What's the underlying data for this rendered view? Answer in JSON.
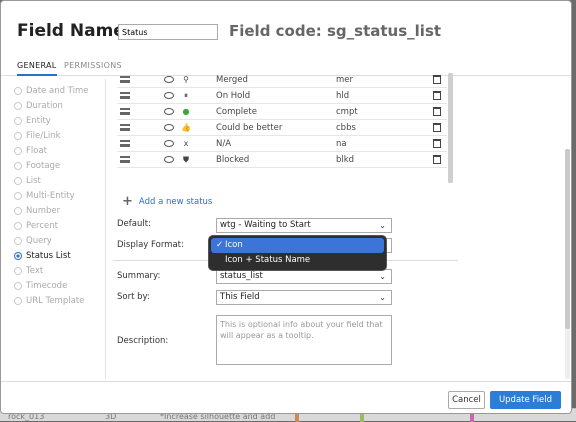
{
  "header": {
    "title": "Field Name",
    "name_value": "Status",
    "field_code": "Field code: sg_status_list"
  },
  "tabs": {
    "general": "GENERAL",
    "permissions": "PERMISSIONS"
  },
  "types": [
    "Date and Time",
    "Duration",
    "Entity",
    "File/Link",
    "Float",
    "Footage",
    "List",
    "Multi-Entity",
    "Number",
    "Percent",
    "Query",
    "Status List",
    "Text",
    "Timecode",
    "URL Template"
  ],
  "selected_type": "Status List",
  "statuses": [
    {
      "name": "Merged",
      "code": "mer",
      "icon": "merge-icon",
      "glyph": "⚲"
    },
    {
      "name": "On Hold",
      "code": "hld",
      "icon": "pause-icon",
      "glyph": "⏸"
    },
    {
      "name": "Complete",
      "code": "cmpt",
      "icon": "complete-dot-icon",
      "glyph": "●",
      "color": "#3aa83a"
    },
    {
      "name": "Could be better",
      "code": "cbbs",
      "icon": "thumbs-up-icon",
      "glyph": "👍",
      "color": "#4caa3c"
    },
    {
      "name": "N/A",
      "code": "na",
      "icon": "x-icon",
      "glyph": "x"
    },
    {
      "name": "Blocked",
      "code": "blkd",
      "icon": "blocked-shield-icon",
      "glyph": "⛊"
    }
  ],
  "add_status": "Add a new status",
  "form": {
    "default_label": "Default:",
    "default_value": "wtg - Waiting to Start",
    "display_format_label": "Display Format:",
    "summary_label": "Summary:",
    "summary_value": "status_list",
    "sortby_label": "Sort by:",
    "sortby_value": "This Field",
    "description_label": "Description:",
    "description_placeholder": "This is optional info about your field that will appear as a tooltip."
  },
  "display_format_menu": {
    "options": [
      "Icon",
      "Icon + Status Name"
    ],
    "selected": "Icon",
    "check": "✓"
  },
  "footer": {
    "cancel": "Cancel",
    "update": "Update Field"
  },
  "background_row": {
    "c1": "rock_013",
    "c2": "3D",
    "c3": "*Increase silhouette and add"
  },
  "colors": {
    "accent": "#2b7ed8",
    "menu_bg": "#2e2e2e",
    "menu_highlight": "#3d74d8"
  }
}
